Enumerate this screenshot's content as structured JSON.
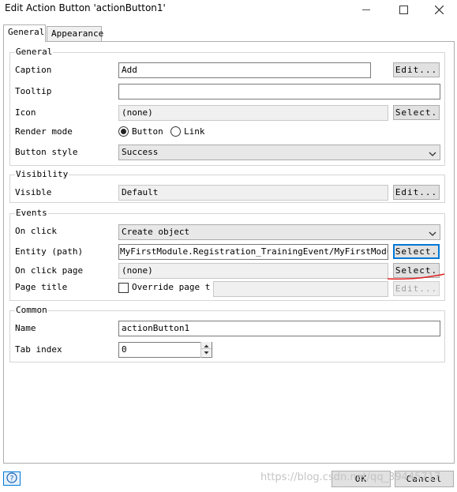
{
  "window": {
    "title": "Edit Action Button 'actionButton1'"
  },
  "tabs": [
    {
      "label": "General",
      "active": true
    },
    {
      "label": "Appearance",
      "active": false
    }
  ],
  "general": {
    "title": "General",
    "caption_label": "Caption",
    "caption_value": "Add",
    "caption_button": "Edit...",
    "tooltip_label": "Tooltip",
    "tooltip_value": "",
    "icon_label": "Icon",
    "icon_value": "(none)",
    "icon_button": "Select.",
    "render_mode_label": "Render mode",
    "render_mode_options": [
      "Button",
      "Link"
    ],
    "render_mode_selected": "Button",
    "button_style_label": "Button style",
    "button_style_value": "Success"
  },
  "visibility": {
    "title": "Visibility",
    "visible_label": "Visible",
    "visible_value": "Default",
    "visible_button": "Edit..."
  },
  "events": {
    "title": "Events",
    "on_click_label": "On click",
    "on_click_value": "Create object",
    "entity_label": "Entity (path)",
    "entity_value": "MyFirstModule.Registration_TrainingEvent/MyFirstModule.R",
    "entity_button": "Select.",
    "on_click_page_label": "On click page",
    "on_click_page_value": "(none)",
    "on_click_page_button": "Select.",
    "page_title_label": "Page title",
    "page_title_check_label": "Override page t",
    "page_title_value": "",
    "page_title_button": "Edit...",
    "annotation_color": "#e02020"
  },
  "common": {
    "title": "Common",
    "name_label": "Name",
    "name_value": "actionButton1",
    "tab_index_label": "Tab index",
    "tab_index_value": "0"
  },
  "footer": {
    "ok_label": "OK",
    "cancel_label": "Cancel",
    "watermark": "https://blog.csdn.net/qq_39445717"
  },
  "icons": {
    "minimize": "minimize-icon",
    "maximize": "maximize-icon",
    "close": "close-icon",
    "help": "help-icon",
    "dropdown": "chevron-down-icon"
  },
  "colors": {
    "focus": "#0078d7",
    "annotation": "#e02020"
  }
}
